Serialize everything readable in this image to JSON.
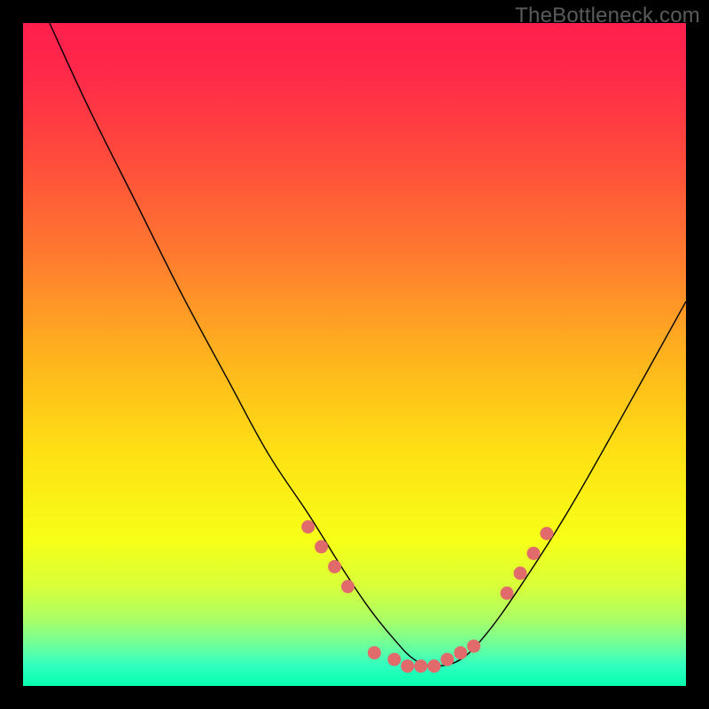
{
  "watermark": "TheBottleneck.com",
  "colors": {
    "dot": "#e16a6a",
    "curve": "#000000",
    "frame": "#000000",
    "gradient_stops": [
      {
        "offset": 0.0,
        "color": "#ff1f4d"
      },
      {
        "offset": 0.08,
        "color": "#ff2a49"
      },
      {
        "offset": 0.2,
        "color": "#ff4a3c"
      },
      {
        "offset": 0.35,
        "color": "#ff7a2f"
      },
      {
        "offset": 0.5,
        "color": "#ffb21e"
      },
      {
        "offset": 0.65,
        "color": "#ffe114"
      },
      {
        "offset": 0.78,
        "color": "#f7ff17"
      },
      {
        "offset": 0.85,
        "color": "#d8ff3a"
      },
      {
        "offset": 0.9,
        "color": "#aaff66"
      },
      {
        "offset": 0.94,
        "color": "#6bff9e"
      },
      {
        "offset": 0.97,
        "color": "#2fffc0"
      },
      {
        "offset": 1.0,
        "color": "#05ffad"
      }
    ]
  },
  "chart_data": {
    "type": "line",
    "title": "",
    "xlabel": "",
    "ylabel": "",
    "xlim": [
      0,
      100
    ],
    "ylim": [
      0,
      100
    ],
    "grid": false,
    "note": "Axes unlabeled; values estimated from pixel positions (0–100 each axis, y increases upward). Curve is a bottleneck valley with minimum near x≈60.",
    "series": [
      {
        "name": "curve",
        "x": [
          4,
          10,
          17,
          24,
          31,
          37,
          43,
          48,
          52,
          56,
          59,
          62,
          66,
          70,
          75,
          82,
          90,
          100
        ],
        "y": [
          100,
          87,
          73,
          59,
          46,
          35,
          26,
          18,
          12,
          7,
          4,
          3,
          4,
          8,
          15,
          26,
          40,
          58
        ]
      },
      {
        "name": "highlight-dots",
        "x": [
          43,
          45,
          47,
          49,
          53,
          56,
          58,
          60,
          62,
          64,
          66,
          68,
          73,
          75,
          77,
          79
        ],
        "y": [
          24,
          21,
          18,
          15,
          5,
          4,
          3,
          3,
          3,
          4,
          5,
          6,
          14,
          17,
          20,
          23
        ]
      }
    ]
  }
}
